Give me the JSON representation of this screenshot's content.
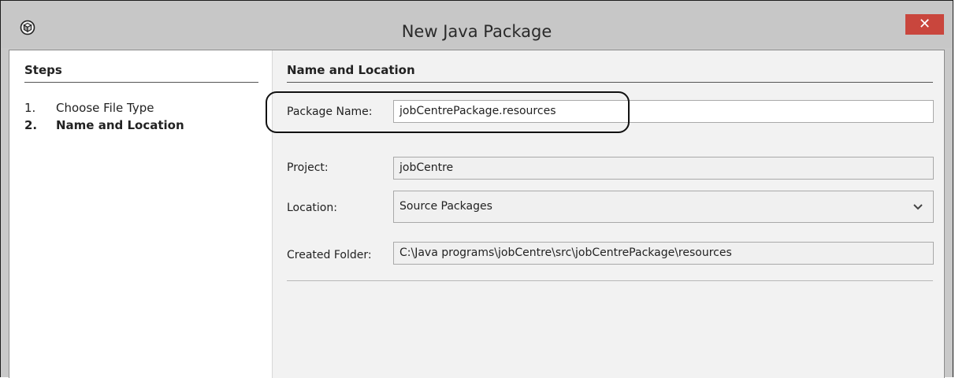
{
  "window": {
    "title": "New Java Package",
    "close_symbol": "✕"
  },
  "steps": {
    "title": "Steps",
    "items": [
      {
        "number": "1.",
        "label": "Choose File Type"
      },
      {
        "number": "2.",
        "label": "Name and Location"
      }
    ]
  },
  "section": {
    "title": "Name and Location",
    "package_name": {
      "label": "Package Name:",
      "value": "jobCentrePackage.resources"
    },
    "project": {
      "label": "Project:",
      "value": "jobCentre"
    },
    "location": {
      "label": "Location:",
      "value": "Source Packages"
    },
    "created_folder": {
      "label": "Created Folder:",
      "value": "C:\\Java programs\\jobCentre\\src\\jobCentrePackage\\resources"
    }
  },
  "colors": {
    "close_button": "#c9463d",
    "titlebar": "#c7c7c7",
    "panel": "#f2f2f2"
  },
  "icons": {
    "app": "package-cube-icon",
    "close": "close-icon",
    "dropdown": "chevron-down-icon"
  }
}
